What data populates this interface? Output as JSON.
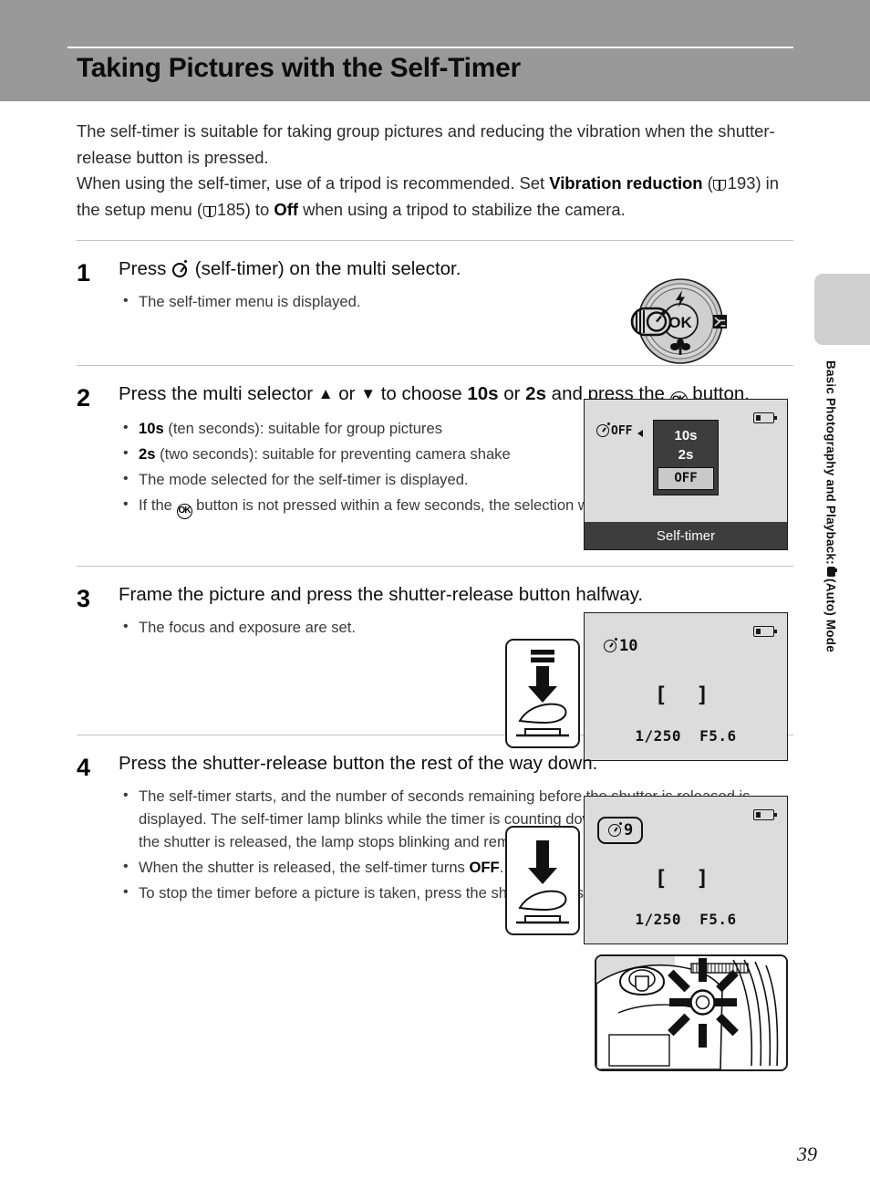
{
  "page": {
    "title": "Taking Pictures with the Self-Timer",
    "number": "39",
    "sidebar_label": "Basic Photography and Playback:",
    "sidebar_label_tail": "(Auto) Mode",
    "header_color": "#999999",
    "accent_color": "#3d3d3d"
  },
  "intro": {
    "line1": "The self-timer is suitable for taking group pictures and reducing the vibration when the shutter-release button is pressed.",
    "p2_a": "When using the self-timer, use of a tripod is recommended. Set ",
    "p2_bold1": "Vibration reduction",
    "p2_ref1": "193",
    "p2_b": ") in the setup menu (",
    "p2_ref2": "185",
    "p2_c": ") to ",
    "p2_bold2": "Off",
    "p2_d": " when using a tripod to stabilize the camera."
  },
  "steps": [
    {
      "num": "1",
      "head_a": "Press ",
      "head_b": " (self-timer) on the multi selector.",
      "bullets": [
        "The self-timer menu is displayed."
      ]
    },
    {
      "num": "2",
      "head_a": "Press the multi selector ",
      "head_up": "▲",
      "head_or": " or ",
      "head_down": "▼",
      "head_b": " to choose ",
      "head_bold1": "10s",
      "head_c": " or ",
      "head_bold2": "2s",
      "head_d": " and press the ",
      "head_e": " button.",
      "bullets": [
        {
          "bold": "10s",
          "rest": " (ten seconds): suitable for group pictures"
        },
        {
          "bold": "2s",
          "rest": " (two seconds): suitable for preventing camera shake"
        },
        {
          "bold": "",
          "rest": "The mode selected for the self-timer is displayed."
        },
        {
          "bold": "",
          "rest": "If the  button is not pressed within a few seconds, the selection will be canceled."
        }
      ]
    },
    {
      "num": "3",
      "head": "Frame the picture and press the shutter-release button halfway.",
      "bullets": [
        "The focus and exposure are set."
      ]
    },
    {
      "num": "4",
      "head": "Press the shutter-release button the rest of the way down.",
      "bullets": [
        "The self-timer starts, and the number of seconds remaining before the shutter is released is displayed. The self-timer lamp blinks while the timer is counting down. About one second before the shutter is released, the lamp stops blinking and remains lit.",
        "When the shutter is released, the self-timer turns OFF.",
        "To stop the timer before a picture is taken, press the shutter-release button again."
      ],
      "bullet2_prefix": "When the shutter is released, the self-timer turns ",
      "bullet2_bold": "OFF",
      "bullet2_suffix": "."
    }
  ],
  "lcd_step2": {
    "status_off": "OFF",
    "menu_options": [
      "10s",
      "2s",
      "OFF"
    ],
    "selected_option": "OFF",
    "caption": "Self-timer"
  },
  "lcd_step3": {
    "timer_value": "10",
    "shutter_speed": "1/250",
    "aperture": "F5.6"
  },
  "lcd_step4": {
    "timer_value": "9",
    "shutter_speed": "1/250",
    "aperture": "F5.6"
  },
  "dial": {
    "top_icon": "flash-icon",
    "left_icon": "self-timer-icon",
    "right_icon": "exposure-compensation-icon",
    "bottom_icon": "macro-icon",
    "center_label": "OK"
  }
}
